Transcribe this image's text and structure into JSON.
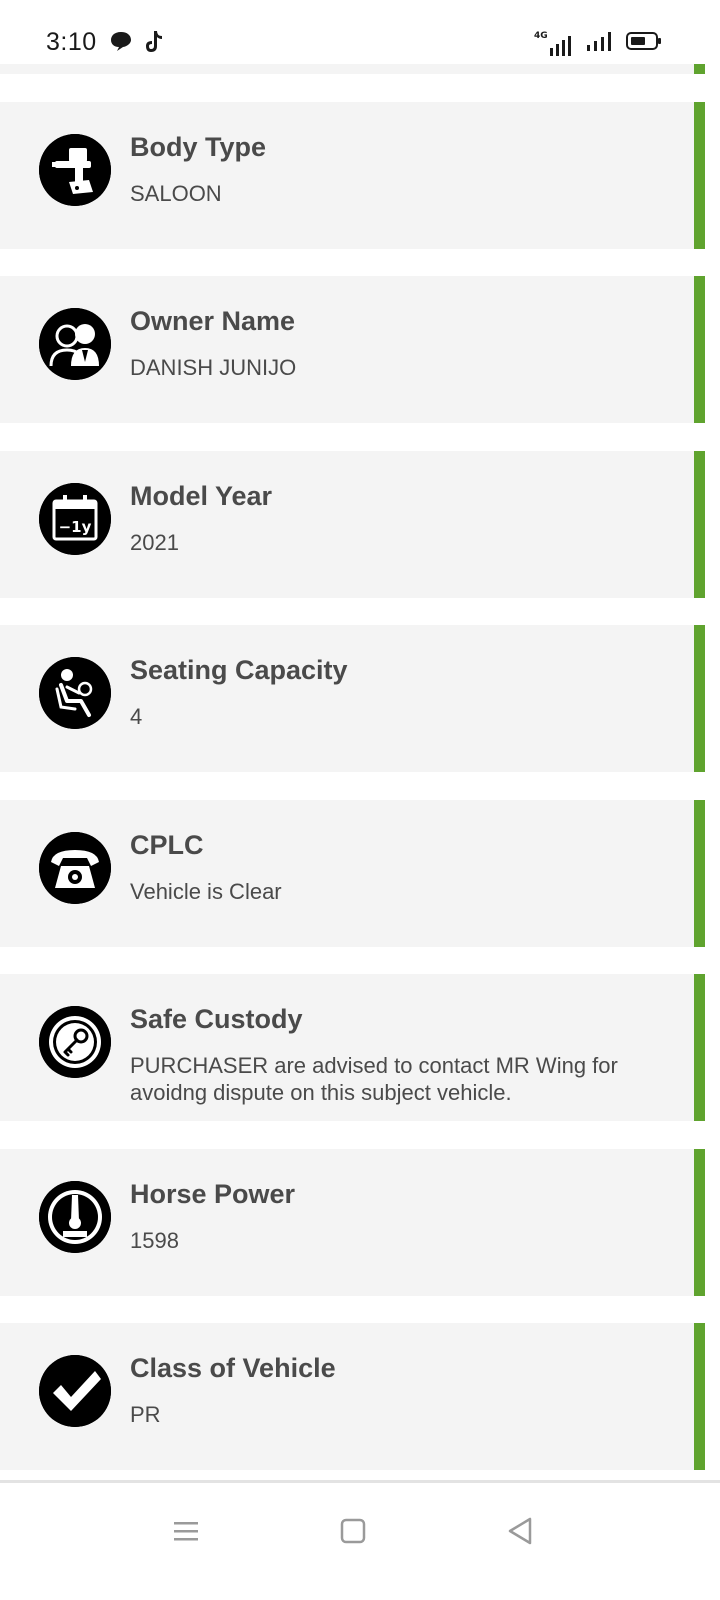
{
  "status_bar": {
    "time": "3:10",
    "left_icons": [
      "chat-bubble-icon",
      "tiktok-icon"
    ],
    "right_icons": [
      "signal-4g-icon",
      "signal-icon",
      "battery-icon"
    ],
    "network_label": "4G"
  },
  "cards": [
    {
      "title": "Body Type",
      "value": "SALOON",
      "icon": "spray-gun-icon"
    },
    {
      "title": "Owner Name",
      "value": "DANISH JUNIJO",
      "icon": "people-icon"
    },
    {
      "title": "Model Year",
      "value": "2021",
      "icon": "calendar-icon",
      "icon_text": "−1y"
    },
    {
      "title": "Seating Capacity",
      "value": "4",
      "icon": "seated-driver-icon"
    },
    {
      "title": "CPLC",
      "value": "Vehicle is Clear",
      "icon": "telephone-icon"
    },
    {
      "title": "Safe Custody",
      "value": "PURCHASER are advised to contact MR Wing for avoidng dispute on this subject vehicle.",
      "icon": "key-icon"
    },
    {
      "title": "Horse Power",
      "value": "1598",
      "icon": "gauge-icon"
    },
    {
      "title": "Class of Vehicle",
      "value": "PR",
      "icon": "checkmark-icon"
    }
  ],
  "colors": {
    "accent": "#5fa32e",
    "card_background": "#f4f4f4",
    "text": "#4a4a4a"
  },
  "nav_bar": [
    "menu-icon",
    "home-square-icon",
    "back-triangle-icon"
  ]
}
